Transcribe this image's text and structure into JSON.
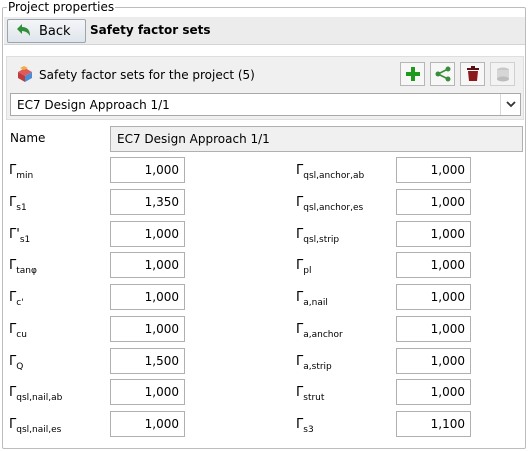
{
  "group_title": "Project properties",
  "toolbar": {
    "back_label": "Back",
    "section_title": "Safety factor sets"
  },
  "sets_panel": {
    "header_label": "Safety factor sets for the project (5)",
    "buttons": [
      "add-icon",
      "share-icon",
      "delete-icon",
      "copy-icon"
    ],
    "selected_set": "EC7 Design Approach 1/1"
  },
  "name_field": {
    "label": "Name",
    "value": "EC7 Design Approach 1/1"
  },
  "left_params": [
    {
      "symbol": "Γ",
      "sub": "min",
      "value": "1,000"
    },
    {
      "symbol": "Γ",
      "sub": "s1",
      "value": "1,350"
    },
    {
      "symbol": "Γ'",
      "sub": "s1",
      "value": "1,000"
    },
    {
      "symbol": "Γ",
      "sub": "tanφ",
      "value": "1,000"
    },
    {
      "symbol": "Γ",
      "sub": "c'",
      "value": "1,000"
    },
    {
      "symbol": "Γ",
      "sub": "cu",
      "value": "1,000"
    },
    {
      "symbol": "Γ",
      "sub": "Q",
      "value": "1,500"
    },
    {
      "symbol": "Γ",
      "sub": "qsl,nail,ab",
      "value": "1,000"
    },
    {
      "symbol": "Γ",
      "sub": "qsl,nail,es",
      "value": "1,000"
    }
  ],
  "right_params": [
    {
      "symbol": "Γ",
      "sub": "qsl,anchor,ab",
      "value": "1,000"
    },
    {
      "symbol": "Γ",
      "sub": "qsl,anchor,es",
      "value": "1,000"
    },
    {
      "symbol": "Γ",
      "sub": "qsl,strip",
      "value": "1,000"
    },
    {
      "symbol": "Γ",
      "sub": "pl",
      "value": "1,000"
    },
    {
      "symbol": "Γ",
      "sub": "a,nail",
      "value": "1,000"
    },
    {
      "symbol": "Γ",
      "sub": "a,anchor",
      "value": "1,000"
    },
    {
      "symbol": "Γ",
      "sub": "a,strip",
      "value": "1,000"
    },
    {
      "symbol": "Γ",
      "sub": "strut",
      "value": "1,000"
    },
    {
      "symbol": "Γ",
      "sub": "s3",
      "value": "1,100"
    }
  ],
  "colors": {
    "add": "#1e9a1e",
    "share": "#3a8d3a",
    "delete": "#8b1a1a",
    "back_arrow": "#2f8f3a"
  }
}
